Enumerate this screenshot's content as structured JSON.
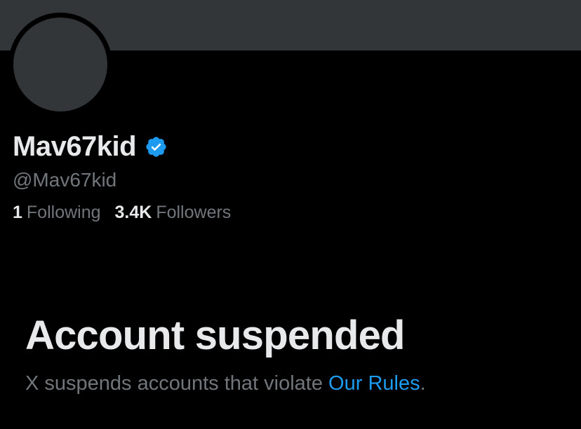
{
  "profile": {
    "display_name": "Mav67kid",
    "handle": "@Mav67kid",
    "verified_icon": "verified-badge-icon",
    "following_count": "1",
    "following_label": "Following",
    "followers_count": "3.4K",
    "followers_label": "Followers"
  },
  "suspension": {
    "title": "Account suspended",
    "description_prefix": "X suspends accounts that violate ",
    "rules_link": "Our Rules",
    "description_suffix": "."
  },
  "colors": {
    "background": "#000000",
    "banner": "#333639",
    "primary_text": "#e7e9ea",
    "secondary_text": "#71767b",
    "accent": "#1d9bf0"
  }
}
